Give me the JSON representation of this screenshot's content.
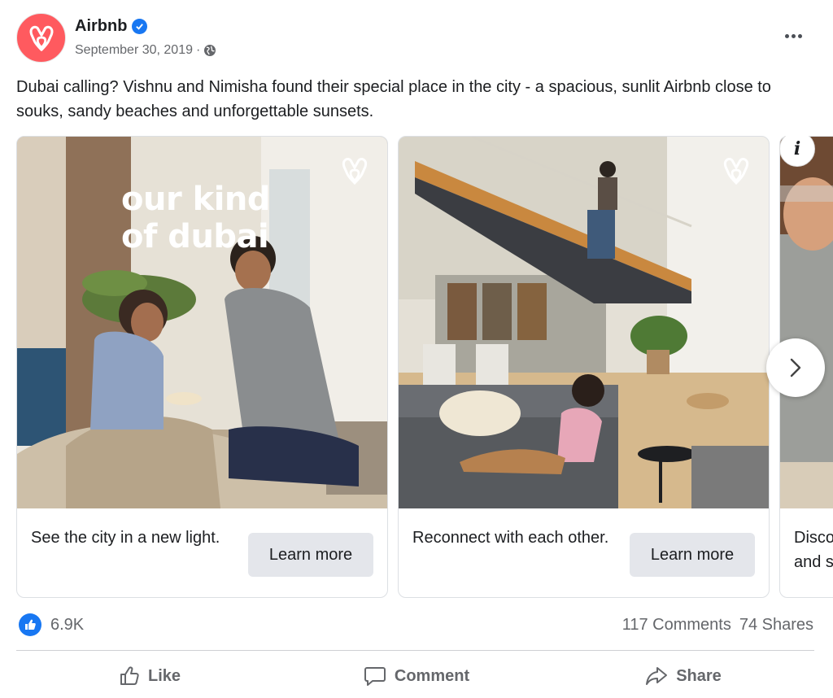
{
  "post": {
    "author": "Airbnb",
    "date": "September 30, 2019",
    "date_separator": "·",
    "caption": "Dubai calling? Vishnu and Nimisha found their special place in the city - a spacious, sunlit Airbnb close to souks, sandy beaches and unforgettable sunsets.",
    "icons": {
      "avatar": "airbnb-logo",
      "verified": "verified-badge-icon",
      "audience": "globe-icon",
      "more": "more-options-icon"
    }
  },
  "carousel": {
    "cards": [
      {
        "overlay_title_line1": "our kind",
        "overlay_title_line2": "of dubai",
        "text": "See the city in a new light.",
        "button": "Learn more"
      },
      {
        "text": "Reconnect with each other.",
        "button": "Learn more"
      },
      {
        "text_partial": "Disco\nand s"
      }
    ],
    "info_label": "i"
  },
  "reactions": {
    "like_count": "6.9K",
    "comments": "117 Comments",
    "shares": "74 Shares"
  },
  "actions": {
    "like": "Like",
    "comment": "Comment",
    "share": "Share"
  },
  "colors": {
    "brand": "#ff5a5f",
    "facebook_blue": "#1877f2",
    "muted_text": "#65676b",
    "button_bg": "#e4e6eb"
  }
}
